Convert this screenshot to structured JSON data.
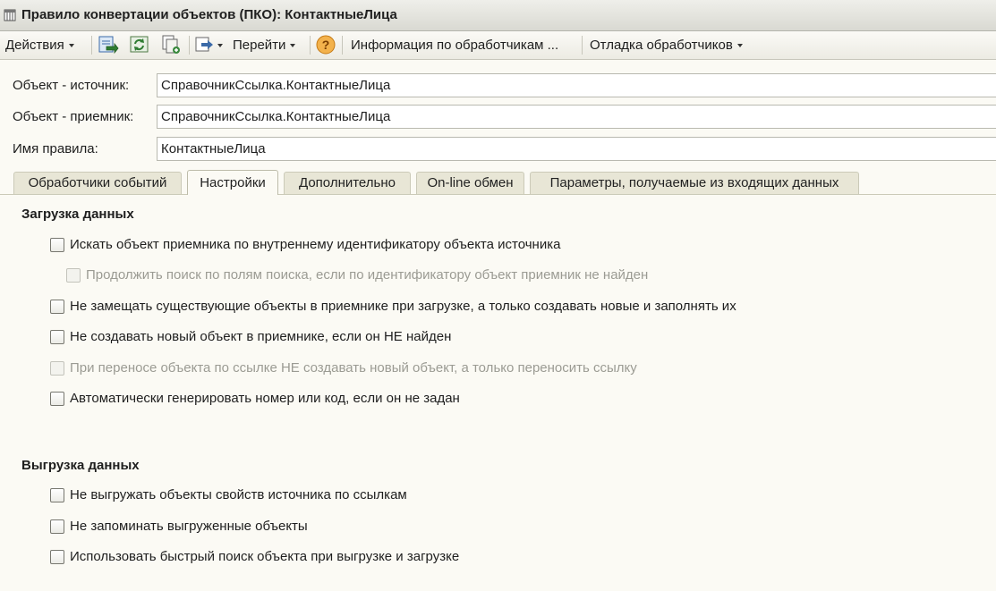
{
  "window": {
    "title": "Правило конвертации объектов (ПКО): КонтактныеЛица"
  },
  "toolbar": {
    "actions_label": "Действия",
    "goto_label": "Перейти",
    "handlers_info_label": "Информация по обработчикам ...",
    "debug_label": "Отладка обработчиков"
  },
  "fields": [
    {
      "label": "Объект - источник:",
      "value": "СправочникСсылка.КонтактныеЛица"
    },
    {
      "label": "Объект - приемник:",
      "value": "СправочникСсылка.КонтактныеЛица"
    },
    {
      "label": "Имя правила:",
      "value": "КонтактныеЛица"
    }
  ],
  "tabs": [
    {
      "label": "Обработчики событий",
      "active": false
    },
    {
      "label": "Настройки",
      "active": true
    },
    {
      "label": "Дополнительно",
      "active": false
    },
    {
      "label": "On-line обмен",
      "active": false
    },
    {
      "label": "Параметры, получаемые из входящих данных",
      "active": false
    }
  ],
  "sections": {
    "load": {
      "title": "Загрузка данных",
      "options": [
        {
          "label": "Искать объект приемника по внутреннему идентификатору объекта источника",
          "checked": false,
          "enabled": true
        },
        {
          "label": "Продолжить поиск по полям поиска, если по идентификатору объект приемник не найден",
          "checked": false,
          "enabled": false
        },
        {
          "label": "Не замещать существующие объекты в приемнике при загрузке, а только создавать новые и заполнять их",
          "checked": false,
          "enabled": true
        },
        {
          "label": "Не создавать новый объект в приемнике, если он НЕ найден",
          "checked": false,
          "enabled": true
        },
        {
          "label": "При переносе объекта по ссылке НЕ создавать новый объект, а только переносить ссылку",
          "checked": false,
          "enabled": false
        },
        {
          "label": "Автоматически генерировать номер или код, если он не задан",
          "checked": false,
          "enabled": true
        }
      ]
    },
    "unload": {
      "title": "Выгрузка данных",
      "options": [
        {
          "label": "Не выгружать объекты свойств источника по ссылкам",
          "checked": false,
          "enabled": true
        },
        {
          "label": "Не запоминать выгруженные объекты",
          "checked": false,
          "enabled": true
        },
        {
          "label": "Использовать быстрый поиск объекта при выгрузке и загрузке",
          "checked": false,
          "enabled": true
        }
      ]
    }
  },
  "colors": {
    "background": "#fbfaf4",
    "tab_inactive": "#e8e6d6",
    "disabled_text": "#9b9b93",
    "help_icon": "#f0a030"
  },
  "icons": [
    "window-form-icon",
    "save-icon",
    "refresh-icon",
    "copy-icon",
    "navigate-icon",
    "help-icon"
  ]
}
